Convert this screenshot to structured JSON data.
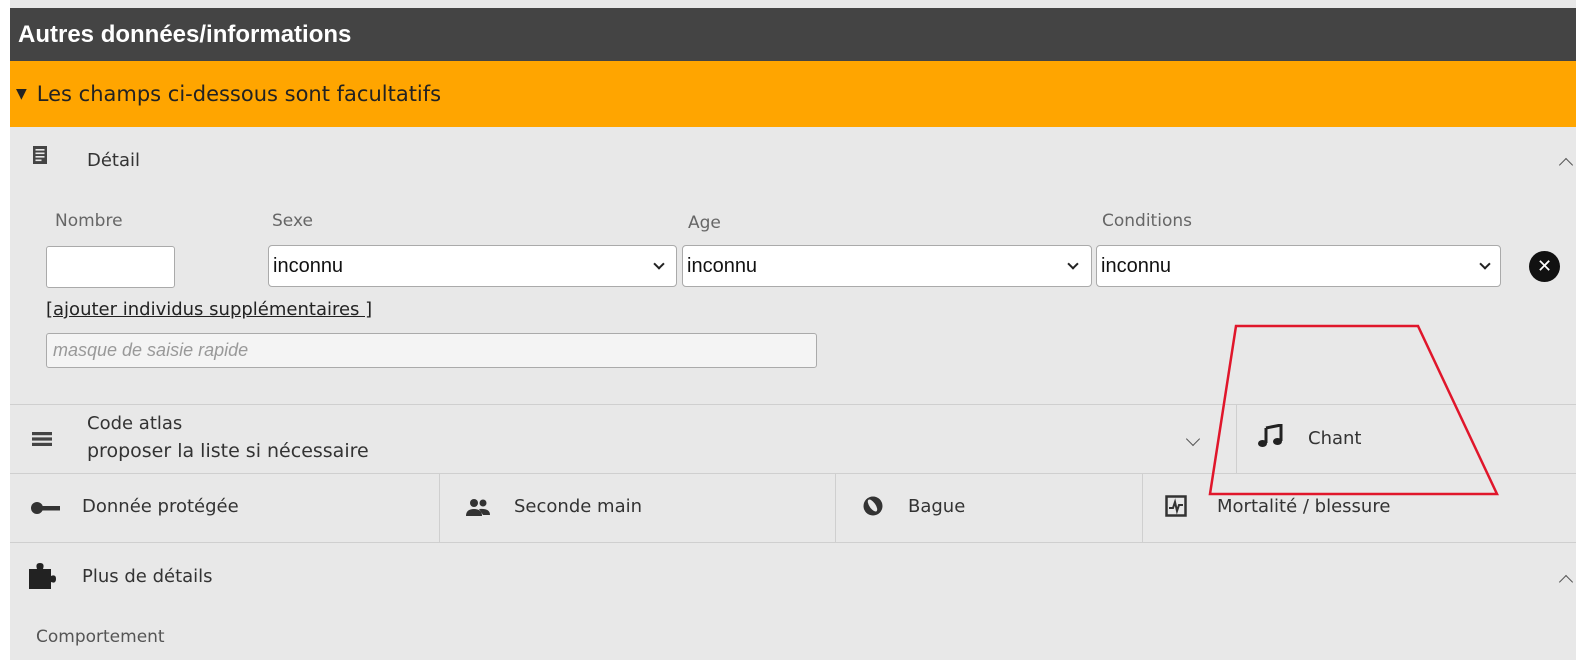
{
  "header": {
    "title": "Autres données/informations"
  },
  "optional": {
    "label": "Les champs ci-dessous sont facultatifs"
  },
  "detail": {
    "title": "Détail",
    "labels": {
      "nombre": "Nombre",
      "sexe": "Sexe",
      "age": "Age",
      "conditions": "Conditions"
    },
    "values": {
      "nombre": "",
      "sexe": "inconnu",
      "age": "inconnu",
      "conditions": "inconnu"
    },
    "add_link": "[ajouter individus supplémentaires ]",
    "quick_placeholder": "masque de saisie rapide"
  },
  "code_atlas": {
    "title": "Code atlas",
    "subtitle": "proposer la liste si nécessaire"
  },
  "chant": {
    "label": "Chant"
  },
  "options": [
    {
      "label": "Donnée protégée",
      "icon": "key-icon"
    },
    {
      "label": "Seconde main",
      "icon": "users-icon"
    },
    {
      "label": "Bague",
      "icon": "ring-icon"
    },
    {
      "label": "Mortalité / blessure",
      "icon": "pulse-icon"
    }
  ],
  "more_details": {
    "title": "Plus de détails",
    "behavior_label": "Comportement"
  },
  "colors": {
    "header_bg": "#444444",
    "optional_bg": "#ffa500",
    "panel_bg": "#e8e8e8",
    "annotation": "#e0162b"
  }
}
